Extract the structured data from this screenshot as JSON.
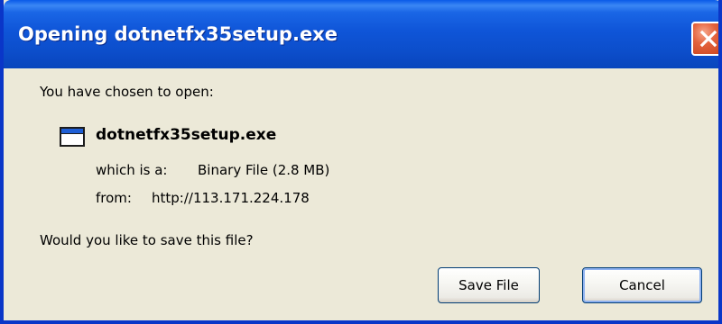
{
  "dialog": {
    "title": "Opening dotnetfx35setup.exe",
    "prompt": "You have chosen to open:",
    "file": {
      "name": "dotnetfx35setup.exe",
      "icon": "application-window-icon",
      "type_label": "which is a:",
      "type_value": "Binary File (2.8 MB)",
      "from_label": "from:",
      "from_value": "http://113.171.224.178"
    },
    "question": "Would you like to save this file?",
    "buttons": {
      "save_label": "Save File",
      "cancel_label": "Cancel"
    }
  },
  "colors": {
    "titlebar": "#0a52d8",
    "dialog_background": "#ece9d8",
    "close_button": "#e3623c",
    "button_border": "#003c74"
  }
}
